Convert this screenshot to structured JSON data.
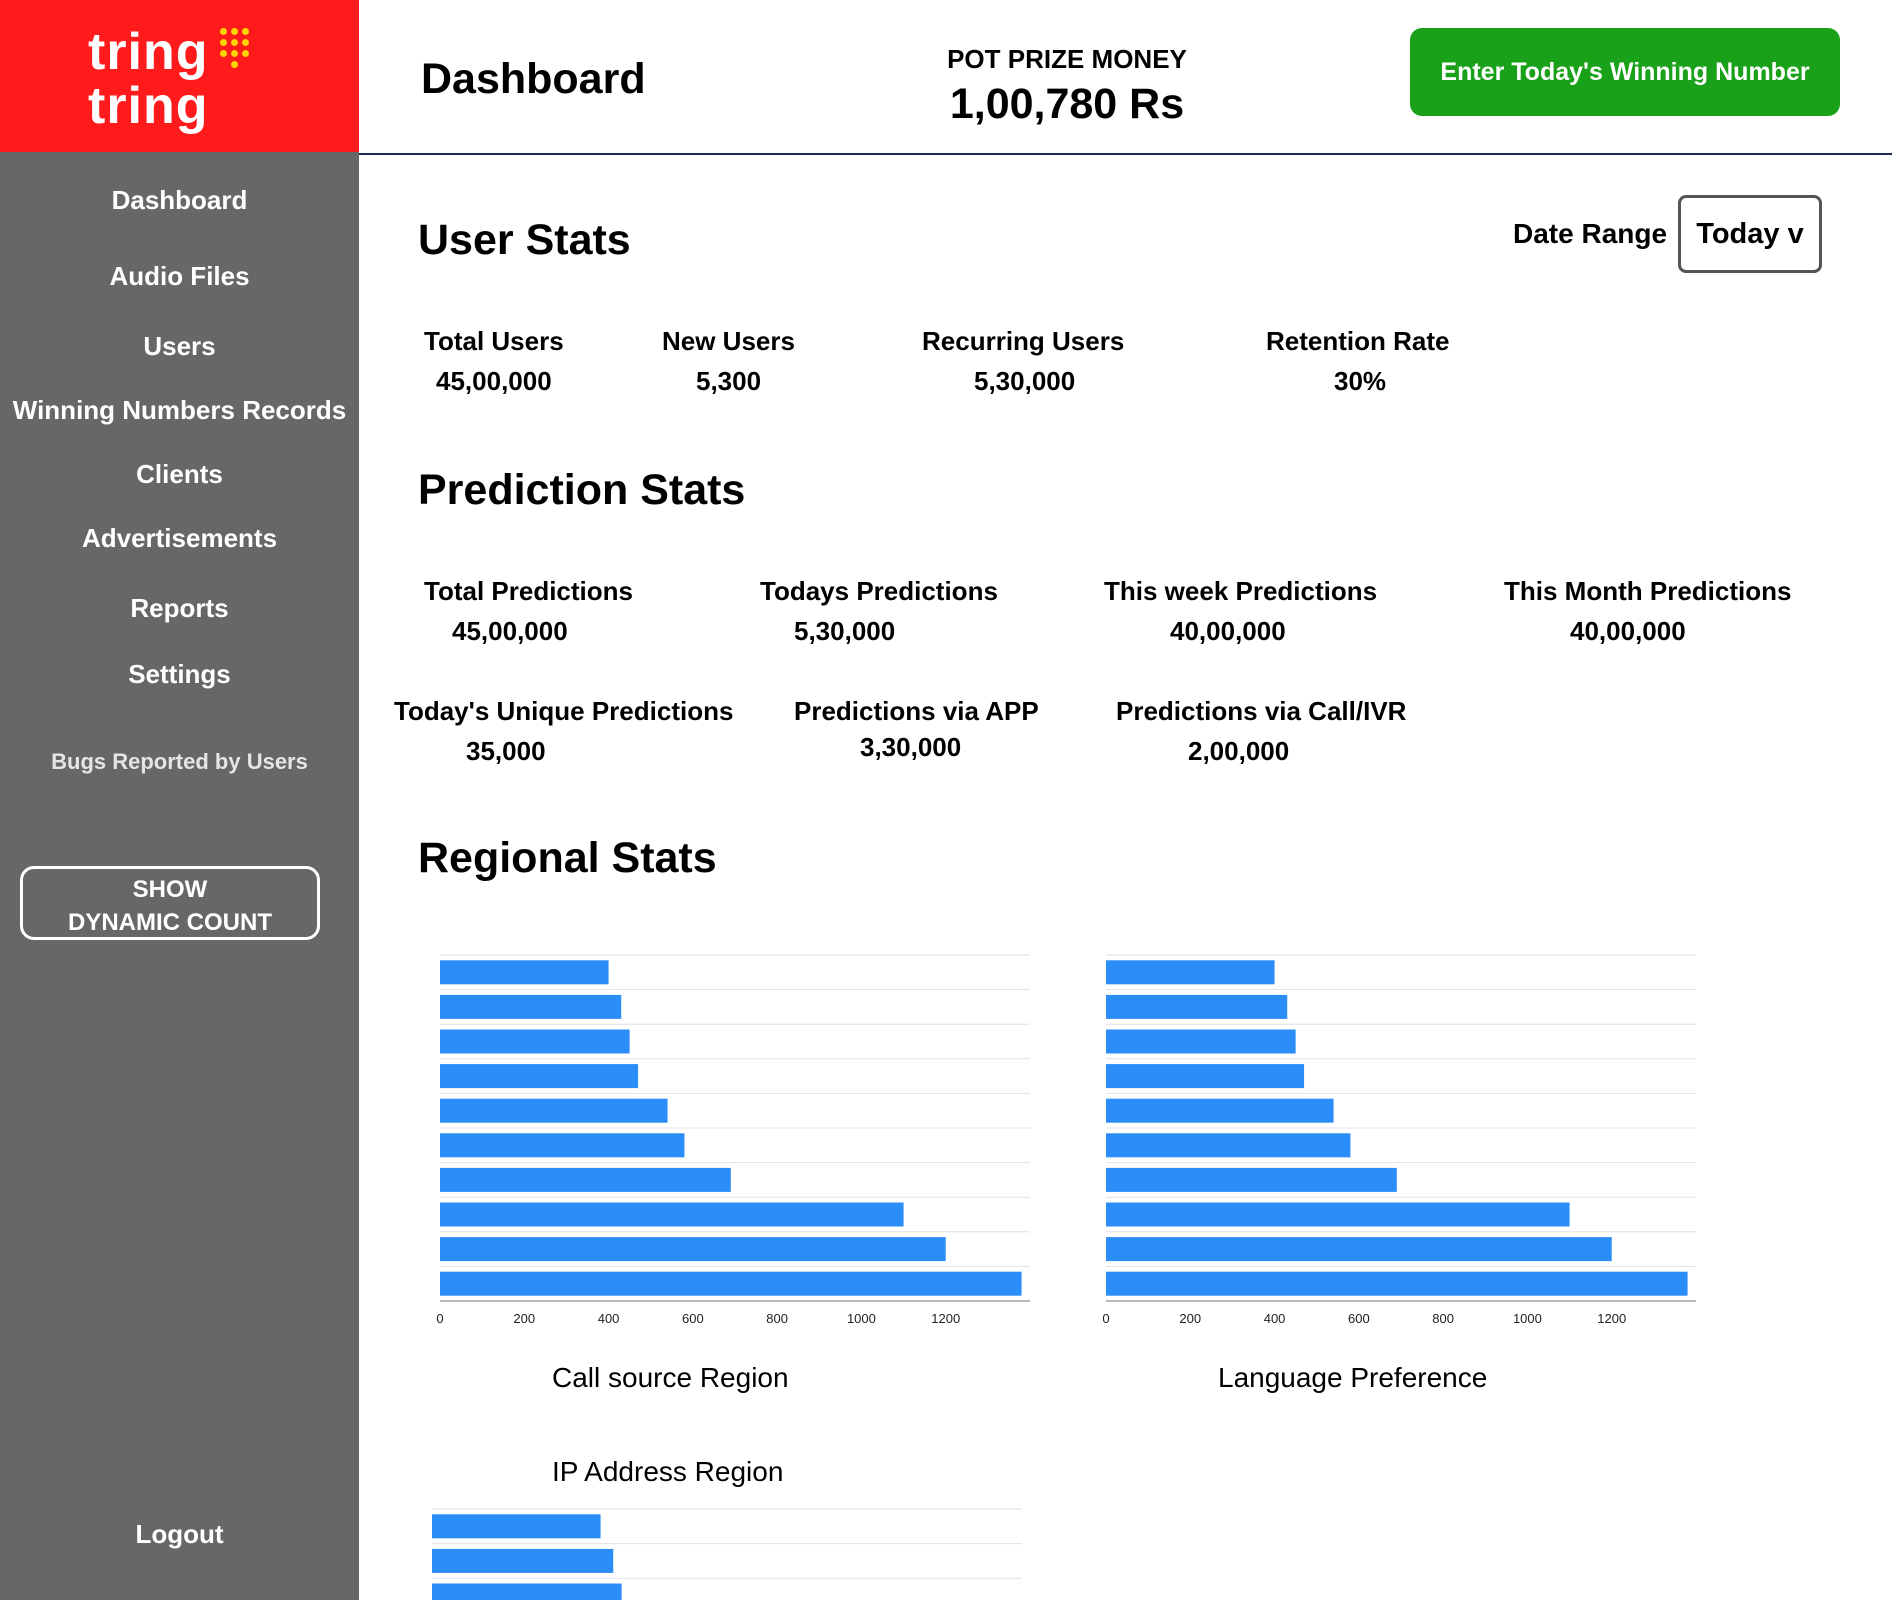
{
  "brand": {
    "line1": "tring",
    "line2": "tring"
  },
  "colors": {
    "sidebar": "#676767",
    "logo_bg": "#ff1b1b",
    "accent": "#1aa11a",
    "bar": "#2b8ef8"
  },
  "sidebar": {
    "items": [
      {
        "label": "Dashboard"
      },
      {
        "label": "Audio Files"
      },
      {
        "label": "Users"
      },
      {
        "label": "Winning Numbers Records"
      },
      {
        "label": "Clients"
      },
      {
        "label": "Advertisements"
      },
      {
        "label": "Reports"
      },
      {
        "label": "Settings"
      },
      {
        "label": "Bugs Reported by Users"
      }
    ],
    "dynamic_button": {
      "line1": "SHOW",
      "line2": "DYNAMIC COUNT"
    },
    "logout": "Logout"
  },
  "header": {
    "title": "Dashboard",
    "pot_label": "POT PRIZE MONEY",
    "pot_value": "1,00,780 Rs",
    "action_button": "Enter Today's Winning Number"
  },
  "user_stats": {
    "title": "User Stats",
    "date_range_label": "Date Range",
    "date_range_value": "Today v",
    "items": [
      {
        "label": "Total Users",
        "value": "45,00,000"
      },
      {
        "label": "New Users",
        "value": "5,300"
      },
      {
        "label": "Recurring Users",
        "value": "5,30,000"
      },
      {
        "label": "Retention Rate",
        "value": "30%"
      }
    ]
  },
  "prediction_stats": {
    "title": "Prediction Stats",
    "items": [
      {
        "label": "Total Predictions",
        "value": "45,00,000"
      },
      {
        "label": "Todays Predictions",
        "value": "5,30,000"
      },
      {
        "label": "This week Predictions",
        "value": "40,00,000"
      },
      {
        "label": "This Month Predictions",
        "value": "40,00,000"
      },
      {
        "label": "Today's Unique Predictions",
        "value": "35,000"
      },
      {
        "label": "Predictions via APP",
        "value": "3,30,000"
      },
      {
        "label": "Predictions via Call/IVR",
        "value": "2,00,000"
      }
    ]
  },
  "regional_stats": {
    "title": "Regional Stats"
  },
  "chart_data": [
    {
      "type": "bar",
      "orientation": "horizontal",
      "title": "Call source Region",
      "values": [
        400,
        430,
        450,
        470,
        540,
        580,
        690,
        1100,
        1200,
        1380
      ],
      "xticks": [
        "0",
        "200",
        "400",
        "600",
        "800",
        "1000",
        "1200"
      ],
      "xlim": [
        0,
        1400
      ],
      "grid": true
    },
    {
      "type": "bar",
      "orientation": "horizontal",
      "title": "Language Preference",
      "values": [
        400,
        430,
        450,
        470,
        540,
        580,
        690,
        1100,
        1200,
        1380
      ],
      "xticks": [
        "0",
        "200",
        "400",
        "600",
        "800",
        "1000",
        "1200"
      ],
      "xlim": [
        0,
        1400
      ],
      "grid": true
    },
    {
      "type": "bar",
      "orientation": "horizontal",
      "title": "IP Address Region",
      "values": [
        400,
        430,
        450
      ],
      "xlim": [
        0,
        1400
      ],
      "grid": true
    }
  ]
}
